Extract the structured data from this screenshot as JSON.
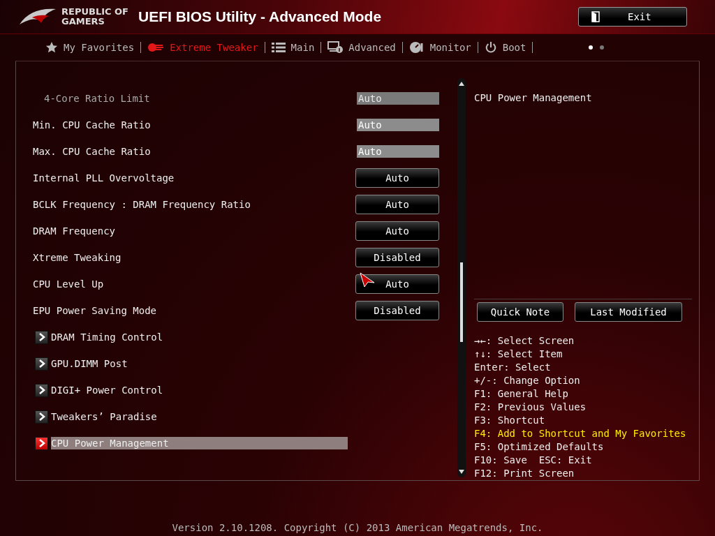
{
  "header": {
    "logo_line1": "REPUBLIC OF",
    "logo_line2": "GAMERS",
    "title": "UEFI BIOS Utility - Advanced Mode",
    "exit_button": "Exit"
  },
  "tabs": [
    {
      "label": "My Favorites",
      "selected": false
    },
    {
      "label": "Extreme Tweaker",
      "selected": true
    },
    {
      "label": "Main",
      "selected": false
    },
    {
      "label": "Advanced",
      "selected": false
    },
    {
      "label": "Monitor",
      "selected": false
    },
    {
      "label": "Boot",
      "selected": false
    }
  ],
  "pager": [
    {
      "selected": true
    },
    {
      "selected": false
    }
  ],
  "settings": [
    {
      "kind": "field",
      "label": "4-Core Ratio Limit",
      "value": "Auto",
      "disabled": true,
      "selected": false
    },
    {
      "kind": "field",
      "label": "Min. CPU Cache Ratio",
      "value": "Auto",
      "disabled": false,
      "selected": false
    },
    {
      "kind": "field",
      "label": "Max. CPU Cache Ratio",
      "value": "Auto",
      "disabled": false,
      "selected": false
    },
    {
      "kind": "option",
      "label": "Internal PLL Overvoltage",
      "value": "Auto",
      "disabled": false,
      "selected": false
    },
    {
      "kind": "option",
      "label": "BCLK Frequency : DRAM Frequency Ratio",
      "value": "Auto",
      "disabled": false,
      "selected": false
    },
    {
      "kind": "option",
      "label": "DRAM Frequency",
      "value": "Auto",
      "disabled": false,
      "selected": false
    },
    {
      "kind": "option",
      "label": "Xtreme Tweaking",
      "value": "Disabled",
      "disabled": false,
      "selected": false
    },
    {
      "kind": "option",
      "label": "CPU Level Up",
      "value": "Auto",
      "disabled": false,
      "selected": false
    },
    {
      "kind": "option",
      "label": "EPU Power Saving Mode",
      "value": "Disabled",
      "disabled": false,
      "selected": false
    },
    {
      "kind": "submenu",
      "label": "DRAM Timing Control",
      "disabled": false,
      "selected": false
    },
    {
      "kind": "submenu",
      "label": "GPU.DIMM Post",
      "disabled": false,
      "selected": false
    },
    {
      "kind": "submenu",
      "label": "DIGI+ Power Control",
      "disabled": false,
      "selected": false
    },
    {
      "kind": "submenu",
      "label": "Tweakers’ Paradise",
      "disabled": false,
      "selected": false
    },
    {
      "kind": "submenu",
      "label": "CPU Power Management",
      "disabled": false,
      "selected": true
    }
  ],
  "help": {
    "description": "CPU Power Management",
    "buttons": [
      "Quick Note",
      "Last Modified"
    ],
    "keys": [
      {
        "text": "→←: Select Screen",
        "highlighted": false
      },
      {
        "text": "↑↓: Select Item",
        "highlighted": false
      },
      {
        "text": "Enter: Select",
        "highlighted": false
      },
      {
        "text": "+/-: Change Option",
        "highlighted": false
      },
      {
        "text": "F1: General Help",
        "highlighted": false
      },
      {
        "text": "F2: Previous Values",
        "highlighted": false
      },
      {
        "text": "F3: Shortcut",
        "highlighted": false
      },
      {
        "text": "F4: Add to Shortcut and My Favorites",
        "highlighted": true
      },
      {
        "text": "F5: Optimized Defaults",
        "highlighted": false
      },
      {
        "text": "F10: Save  ESC: Exit",
        "highlighted": false
      },
      {
        "text": "F12: Print Screen",
        "highlighted": false
      }
    ]
  },
  "footer": "Version 2.10.1208. Copyright (C) 2013 American Megatrends, Inc."
}
